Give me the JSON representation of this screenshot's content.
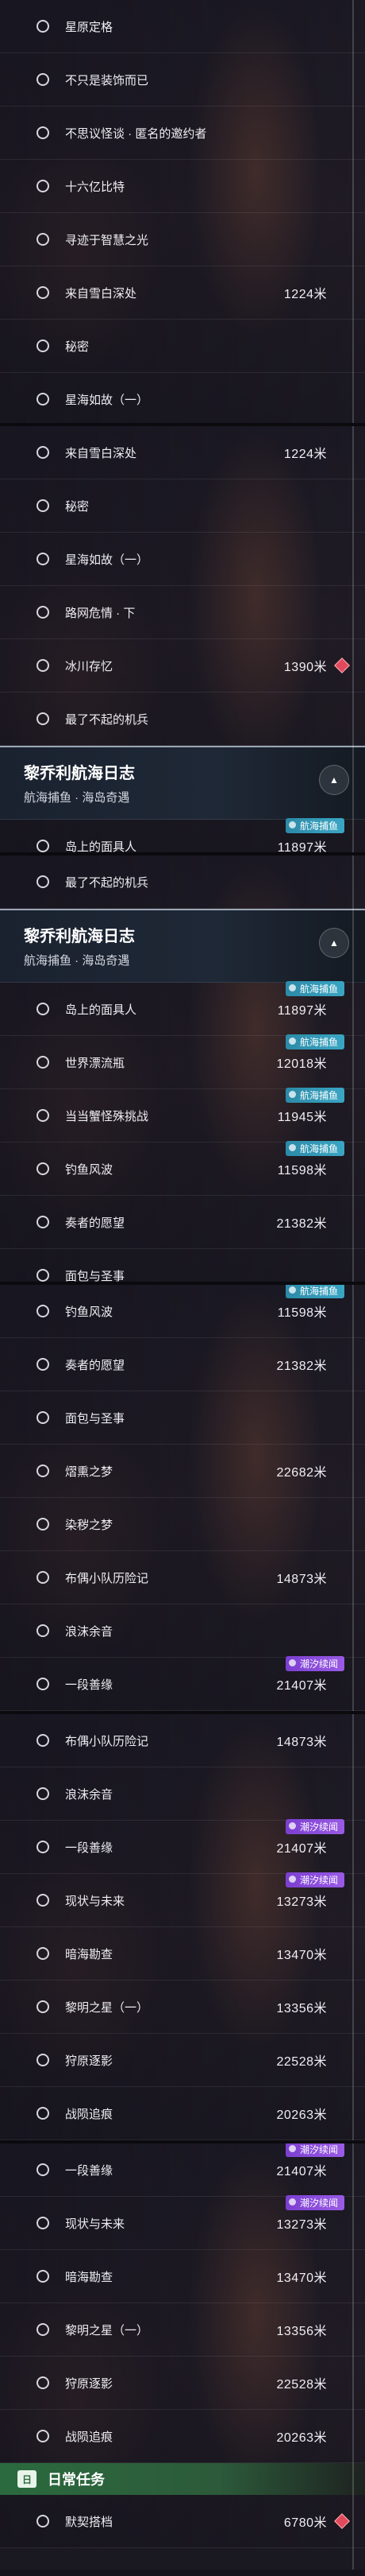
{
  "panels": [
    {
      "items": [
        {
          "label": "星原定格",
          "dist": "",
          "badge": "",
          "badge_type": "",
          "marker": false
        },
        {
          "label": "不只是装饰而已",
          "dist": "",
          "badge": "",
          "badge_type": "",
          "marker": false
        },
        {
          "label": "不思议怪谈 · 匿名的邀约者",
          "dist": "",
          "badge": "",
          "badge_type": "",
          "marker": false
        },
        {
          "label": "十六亿比特",
          "dist": "",
          "badge": "",
          "badge_type": "",
          "marker": false
        },
        {
          "label": "寻迹于智慧之光",
          "dist": "",
          "badge": "",
          "badge_type": "",
          "marker": false
        },
        {
          "label": "来自雪白深处",
          "dist": "1224米",
          "badge": "",
          "badge_type": "",
          "marker": false
        },
        {
          "label": "秘密",
          "dist": "",
          "badge": "",
          "badge_type": "",
          "marker": false
        },
        {
          "label": "星海如故（一）",
          "dist": "",
          "badge": "",
          "badge_type": "",
          "marker": false
        }
      ]
    },
    {
      "items": [
        {
          "label": "来自雪白深处",
          "dist": "1224米",
          "badge": "",
          "badge_type": "",
          "marker": false
        },
        {
          "label": "秘密",
          "dist": "",
          "badge": "",
          "badge_type": "",
          "marker": false
        },
        {
          "label": "星海如故（一）",
          "dist": "",
          "badge": "",
          "badge_type": "",
          "marker": false
        },
        {
          "label": "路网危情 · 下",
          "dist": "",
          "badge": "",
          "badge_type": "",
          "marker": false
        },
        {
          "label": "冰川存忆",
          "dist": "1390米",
          "badge": "",
          "badge_type": "",
          "marker": true
        },
        {
          "label": "最了不起的机兵",
          "dist": "",
          "badge": "",
          "badge_type": "",
          "marker": false
        }
      ],
      "header": {
        "title": "黎乔利航海日志",
        "subtitle": "航海捕鱼 · 海岛奇遇",
        "collapse_icon": "▲"
      },
      "items_after": [
        {
          "label": "岛上的面具人",
          "dist": "11897米",
          "badge": "航海捕鱼",
          "badge_type": "fish",
          "marker": false
        }
      ]
    },
    {
      "items": [
        {
          "label": "最了不起的机兵",
          "dist": "",
          "badge": "",
          "badge_type": "",
          "marker": false
        }
      ],
      "header": {
        "title": "黎乔利航海日志",
        "subtitle": "航海捕鱼 · 海岛奇遇",
        "collapse_icon": "▲"
      },
      "items_after": [
        {
          "label": "岛上的面具人",
          "dist": "11897米",
          "badge": "航海捕鱼",
          "badge_type": "fish",
          "marker": false
        },
        {
          "label": "世界漂流瓶",
          "dist": "12018米",
          "badge": "航海捕鱼",
          "badge_type": "fish",
          "marker": false
        },
        {
          "label": "当当蟹怪殊挑战",
          "dist": "11945米",
          "badge": "航海捕鱼",
          "badge_type": "fish",
          "marker": false
        },
        {
          "label": "钓鱼风波",
          "dist": "11598米",
          "badge": "航海捕鱼",
          "badge_type": "fish",
          "marker": false
        },
        {
          "label": "奏者的愿望",
          "dist": "21382米",
          "badge": "",
          "badge_type": "",
          "marker": false
        },
        {
          "label": "面包与圣事",
          "dist": "",
          "badge": "",
          "badge_type": "",
          "marker": false
        }
      ]
    },
    {
      "items": [
        {
          "label": "钓鱼风波",
          "dist": "11598米",
          "badge": "航海捕鱼",
          "badge_type": "fish",
          "marker": false
        },
        {
          "label": "奏者的愿望",
          "dist": "21382米",
          "badge": "",
          "badge_type": "",
          "marker": false
        },
        {
          "label": "面包与圣事",
          "dist": "",
          "badge": "",
          "badge_type": "",
          "marker": false
        },
        {
          "label": "熠熏之梦",
          "dist": "22682米",
          "badge": "",
          "badge_type": "",
          "marker": false
        },
        {
          "label": "染秽之梦",
          "dist": "",
          "badge": "",
          "badge_type": "",
          "marker": false
        },
        {
          "label": "布偶小队历险记",
          "dist": "14873米",
          "badge": "",
          "badge_type": "",
          "marker": false
        },
        {
          "label": "浪沫余音",
          "dist": "",
          "badge": "",
          "badge_type": "",
          "marker": false
        },
        {
          "label": "一段善缘",
          "dist": "21407米",
          "badge": "潮汐续闻",
          "badge_type": "tide",
          "marker": false
        }
      ]
    },
    {
      "items": [
        {
          "label": "布偶小队历险记",
          "dist": "14873米",
          "badge": "",
          "badge_type": "",
          "marker": false
        },
        {
          "label": "浪沫余音",
          "dist": "",
          "badge": "",
          "badge_type": "",
          "marker": false
        },
        {
          "label": "一段善缘",
          "dist": "21407米",
          "badge": "潮汐续闻",
          "badge_type": "tide",
          "marker": false
        },
        {
          "label": "现状与未来",
          "dist": "13273米",
          "badge": "潮汐续闻",
          "badge_type": "tide",
          "marker": false
        },
        {
          "label": "暗海勘查",
          "dist": "13470米",
          "badge": "",
          "badge_type": "",
          "marker": false
        },
        {
          "label": "黎明之星（一）",
          "dist": "13356米",
          "badge": "",
          "badge_type": "",
          "marker": false
        },
        {
          "label": "狩原逐影",
          "dist": "22528米",
          "badge": "",
          "badge_type": "",
          "marker": false
        },
        {
          "label": "战陨追痕",
          "dist": "20263米",
          "badge": "",
          "badge_type": "",
          "marker": false
        }
      ]
    },
    {
      "items": [
        {
          "label": "一段善缘",
          "dist": "21407米",
          "badge": "潮汐续闻",
          "badge_type": "tide",
          "marker": false
        },
        {
          "label": "现状与未来",
          "dist": "13273米",
          "badge": "潮汐续闻",
          "badge_type": "tide",
          "marker": false
        },
        {
          "label": "暗海勘查",
          "dist": "13470米",
          "badge": "",
          "badge_type": "",
          "marker": false
        },
        {
          "label": "黎明之星（一）",
          "dist": "13356米",
          "badge": "",
          "badge_type": "",
          "marker": false
        },
        {
          "label": "狩原逐影",
          "dist": "22528米",
          "badge": "",
          "badge_type": "",
          "marker": false
        },
        {
          "label": "战陨追痕",
          "dist": "20263米",
          "badge": "",
          "badge_type": "",
          "marker": false
        }
      ],
      "daily": {
        "title": "日常任务",
        "icon_text": "日"
      },
      "items_after": [
        {
          "label": "默契搭档",
          "dist": "6780米",
          "badge": "",
          "badge_type": "",
          "marker": true
        }
      ]
    }
  ]
}
